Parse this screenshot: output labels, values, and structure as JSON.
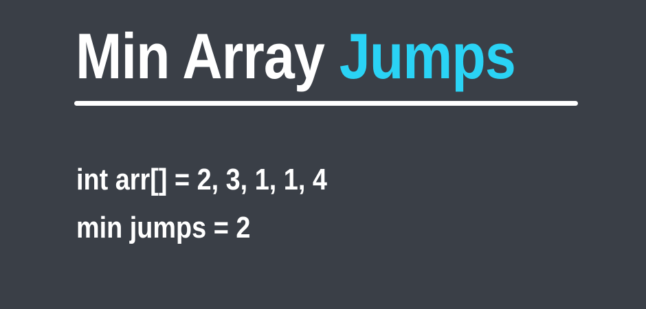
{
  "title": {
    "main": "Min Array ",
    "accent": "Jumps"
  },
  "lines": [
    "int arr[] = 2, 3, 1, 1, 4",
    "min jumps = 2"
  ],
  "colors": {
    "background": "#3a3f47",
    "text": "#ffffff",
    "accent": "#2ad3f5"
  }
}
